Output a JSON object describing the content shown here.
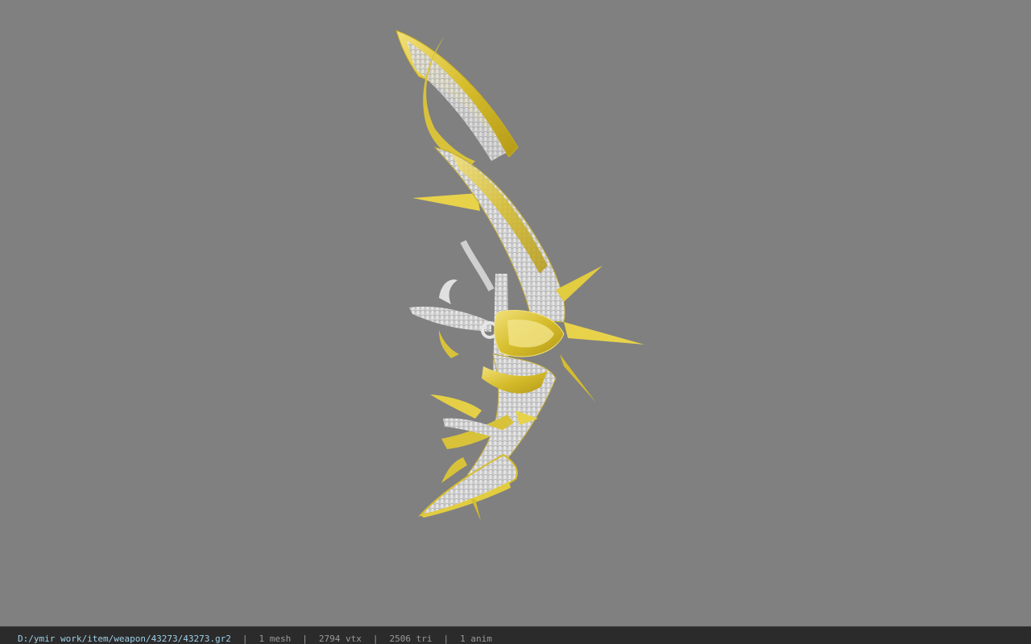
{
  "viewport": {
    "background_color": "#808080",
    "model": {
      "icon": "bow-weapon-model",
      "colors": {
        "gold": "#d8c23a",
        "gold_light": "#f0e070",
        "silver": "#dcdcdc",
        "silver_shadow": "#b4b4b4"
      }
    }
  },
  "statusbar": {
    "file_path": "D:/ymir work/item/weapon/43273/43273.gr2",
    "mesh": "1 mesh",
    "vertices": "2794 vtx",
    "triangles": "2506 tri",
    "animations": "1 anim",
    "separator": "|",
    "colors": {
      "background": "#2b2b2b",
      "path_text": "#9fd0e8",
      "stat_text": "#9a9a9a"
    }
  }
}
